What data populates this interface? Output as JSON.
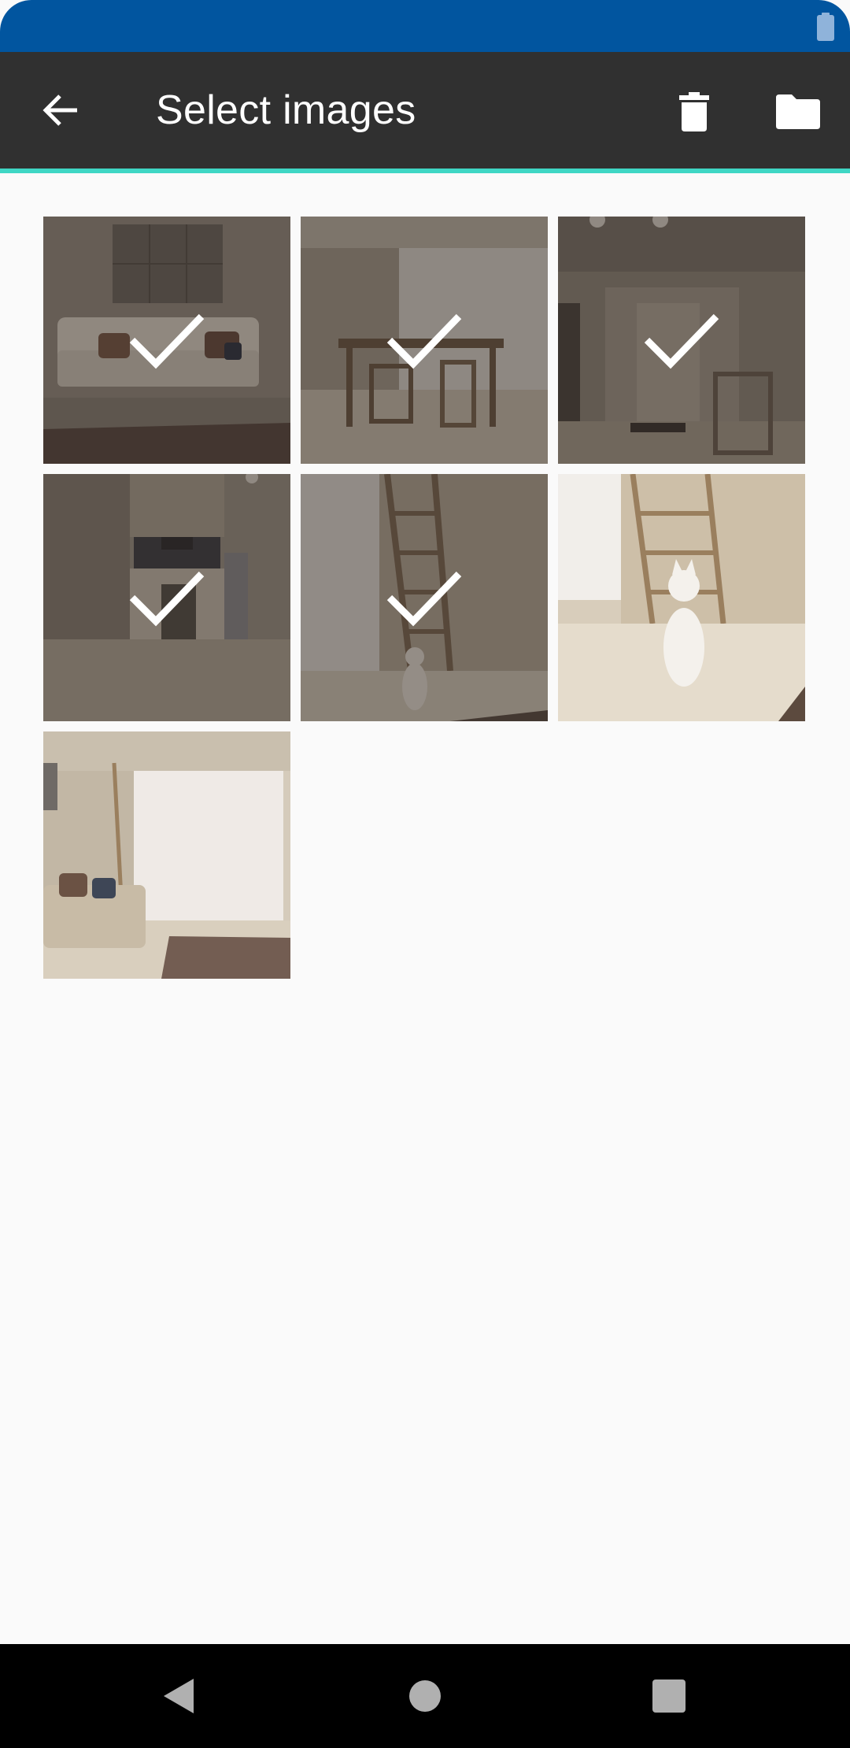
{
  "app_bar": {
    "title": "Select images",
    "back_icon": "arrow-back-icon",
    "actions": [
      {
        "name": "delete",
        "icon": "trash-icon"
      },
      {
        "name": "folder",
        "icon": "folder-icon"
      }
    ]
  },
  "status_bar": {
    "icon": "battery-icon"
  },
  "images": [
    {
      "scene": "living-room-sofa",
      "selected": true
    },
    {
      "scene": "dining-table",
      "selected": true
    },
    {
      "scene": "hallway-door",
      "selected": true
    },
    {
      "scene": "kitchen",
      "selected": true
    },
    {
      "scene": "ladder-shelf-cat-window",
      "selected": true
    },
    {
      "scene": "cat-near-shelf",
      "selected": false
    },
    {
      "scene": "living-room-window-sofa",
      "selected": false
    }
  ],
  "nav_bar": {
    "buttons": [
      {
        "name": "back",
        "icon": "triangle-back-icon"
      },
      {
        "name": "home",
        "icon": "circle-home-icon"
      },
      {
        "name": "recents",
        "icon": "square-recents-icon"
      }
    ]
  },
  "colors": {
    "status_bar": "#01559f",
    "app_bar": "#303030",
    "accent": "#3fd6c4",
    "background": "#fafafa",
    "nav_bar": "#000000"
  }
}
